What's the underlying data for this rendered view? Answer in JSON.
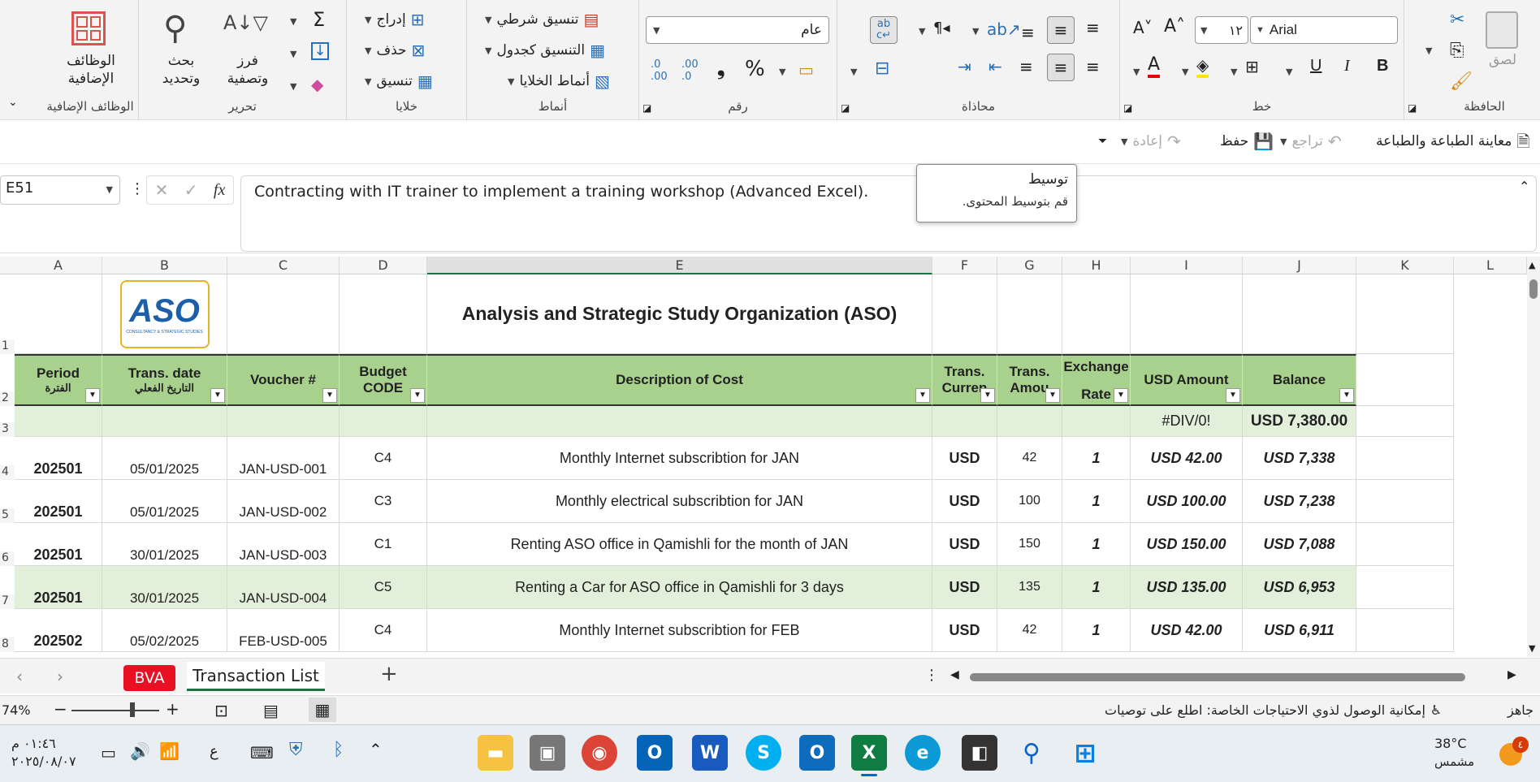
{
  "ribbon": {
    "addins": {
      "label": "الوظائف الإضافية",
      "button": "الوظائف الإضافية"
    },
    "editing": {
      "label": "تحرير",
      "find": "بحث وتحديد",
      "sort": "فرز وتصفية"
    },
    "cells": {
      "label": "خلايا",
      "insert": "إدراج",
      "delete": "حذف",
      "format": "تنسيق"
    },
    "styles": {
      "label": "أنماط",
      "conditional": "تنسيق شرطي",
      "table": "التنسيق كجدول",
      "cellstyles": "أنماط الخلايا"
    },
    "number": {
      "label": "رقم",
      "format": "عام",
      "percent": "%"
    },
    "alignment": {
      "label": "محاذاة"
    },
    "font": {
      "label": "خط",
      "name": "Arial",
      "size": "١٢",
      "bold": "B",
      "italic": "I",
      "underline": "U"
    },
    "clipboard": {
      "label": "الحافظة",
      "paste": "لصق"
    }
  },
  "qat": {
    "print_preview": "معاينة الطباعة والطباعة",
    "undo": "تراجع",
    "save": "حفظ",
    "redo": "إعادة"
  },
  "formula_bar": {
    "name_box": "E51",
    "fx": "fx",
    "content": "Contracting with IT trainer to implement a training workshop (Advanced Excel)."
  },
  "tooltip": {
    "title": "توسيط",
    "body": "قم بتوسيط المحتوى."
  },
  "columns": [
    "A",
    "B",
    "C",
    "D",
    "E",
    "F",
    "G",
    "H",
    "I",
    "J",
    "K",
    "L"
  ],
  "sheet": {
    "logo_text": "ASO",
    "logo_sub": "CONSULTANCY & STRATEGIC STUDIES",
    "title": "Analysis and Strategic Study Organization (ASO)",
    "headers": {
      "period": "Period",
      "period_ar": "الفترة",
      "date": "Trans. date",
      "date_ar": "التاريخ الفعلي",
      "voucher": "Voucher #",
      "budget": "Budget",
      "budget2": "CODE",
      "desc": "Description of Cost",
      "curr": "Trans.",
      "curr2": "Curren",
      "amt": "Trans.",
      "amt2": "Amou",
      "rate": "Exchange",
      "rate2": "Rate",
      "usd": "USD Amount",
      "bal": "Balance"
    },
    "row3": {
      "usd": "#DIV/0!",
      "bal": "USD 7,380.00"
    },
    "rows": [
      {
        "n": "4",
        "period": "202501",
        "date": "05/01/2025",
        "voucher": "JAN-USD-001",
        "code": "C4",
        "desc": "Monthly Internet subscribtion for JAN",
        "curr": "USD",
        "amt": "42",
        "rate": "1",
        "usd": "USD 42.00",
        "bal": "USD 7,338"
      },
      {
        "n": "5",
        "period": "202501",
        "date": "05/01/2025",
        "voucher": "JAN-USD-002",
        "code": "C3",
        "desc": "Monthly electrical subscribtion for JAN",
        "curr": "USD",
        "amt": "100",
        "rate": "1",
        "usd": "USD 100.00",
        "bal": "USD 7,238"
      },
      {
        "n": "6",
        "period": "202501",
        "date": "30/01/2025",
        "voucher": "JAN-USD-003",
        "code": "C1",
        "desc": "Renting ASO office in Qamishli for the month of JAN",
        "curr": "USD",
        "amt": "150",
        "rate": "1",
        "usd": "USD 150.00",
        "bal": "USD 7,088"
      },
      {
        "n": "7",
        "period": "202501",
        "date": "30/01/2025",
        "voucher": "JAN-USD-004",
        "code": "C5",
        "desc": "Renting a Car for ASO office in Qamishli for 3 days",
        "curr": "USD",
        "amt": "135",
        "rate": "1",
        "usd": "USD 135.00",
        "bal": "USD 6,953"
      },
      {
        "n": "8",
        "period": "202502",
        "date": "05/02/2025",
        "voucher": "FEB-USD-005",
        "code": "C4",
        "desc": "Monthly Internet subscribtion for FEB",
        "curr": "USD",
        "amt": "42",
        "rate": "1",
        "usd": "USD 42.00",
        "bal": "USD 6,911"
      }
    ]
  },
  "tabs": {
    "bva": "BVA",
    "transactions": "Transaction List",
    "add": "+"
  },
  "status": {
    "zoom": "74%",
    "ready": "جاهز",
    "accessibility": "إمكانية الوصول لذوي الاحتياجات الخاصة: اطلع على توصيات"
  },
  "taskbar": {
    "time": "٠١:٤٦ م",
    "date": "٢٠٢٥/٠٨/٠٧",
    "temp": "38°C",
    "weather": "مشمس",
    "badge": "٤",
    "lang": "ع"
  }
}
